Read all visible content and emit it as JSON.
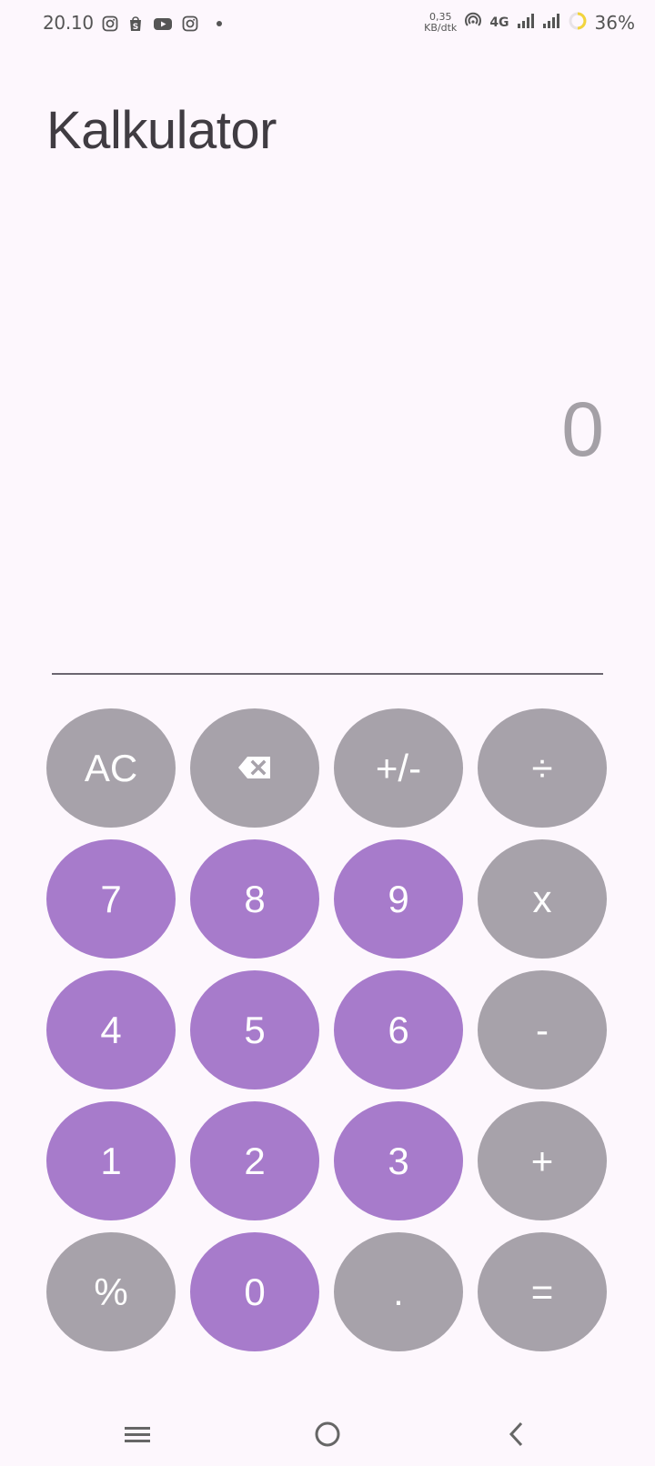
{
  "status_bar": {
    "time": "20.10",
    "left_icons": [
      "instagram-icon",
      "shopee-icon",
      "youtube-icon",
      "instagram-icon"
    ],
    "net_speed_value": "0,35",
    "net_speed_unit": "KB/dtk",
    "network_type": "4G",
    "battery_percent": "36%"
  },
  "app": {
    "title": "Kalkulator"
  },
  "display": {
    "value": "0"
  },
  "keypad": {
    "rows": [
      [
        {
          "label": "AC",
          "style": "gray",
          "name": "all-clear-button"
        },
        {
          "label": "",
          "style": "gray",
          "name": "backspace-button",
          "icon": "backspace-icon"
        },
        {
          "label": "+/-",
          "style": "gray",
          "name": "plus-minus-button"
        },
        {
          "label": "÷",
          "style": "gray",
          "name": "divide-button"
        }
      ],
      [
        {
          "label": "7",
          "style": "purple",
          "name": "digit-7-button"
        },
        {
          "label": "8",
          "style": "purple",
          "name": "digit-8-button"
        },
        {
          "label": "9",
          "style": "purple",
          "name": "digit-9-button"
        },
        {
          "label": "x",
          "style": "gray",
          "name": "multiply-button"
        }
      ],
      [
        {
          "label": "4",
          "style": "purple",
          "name": "digit-4-button"
        },
        {
          "label": "5",
          "style": "purple",
          "name": "digit-5-button"
        },
        {
          "label": "6",
          "style": "purple",
          "name": "digit-6-button"
        },
        {
          "label": "-",
          "style": "gray",
          "name": "subtract-button"
        }
      ],
      [
        {
          "label": "1",
          "style": "purple",
          "name": "digit-1-button"
        },
        {
          "label": "2",
          "style": "purple",
          "name": "digit-2-button"
        },
        {
          "label": "3",
          "style": "purple",
          "name": "digit-3-button"
        },
        {
          "label": "+",
          "style": "gray",
          "name": "add-button"
        }
      ],
      [
        {
          "label": "%",
          "style": "gray",
          "name": "percent-button"
        },
        {
          "label": "0",
          "style": "purple",
          "name": "digit-0-button"
        },
        {
          "label": ".",
          "style": "gray",
          "name": "decimal-button"
        },
        {
          "label": "=",
          "style": "gray",
          "name": "equals-button"
        }
      ]
    ]
  },
  "nav_bar": {
    "buttons": [
      "menu-icon",
      "home-icon",
      "back-icon"
    ]
  },
  "colors": {
    "background": "#fdf7fd",
    "key_gray": "#a7a2aa",
    "key_purple": "#a77bcb",
    "key_text": "#ffffff",
    "display_text": "#a4a0a6",
    "title_text": "#403c42"
  }
}
